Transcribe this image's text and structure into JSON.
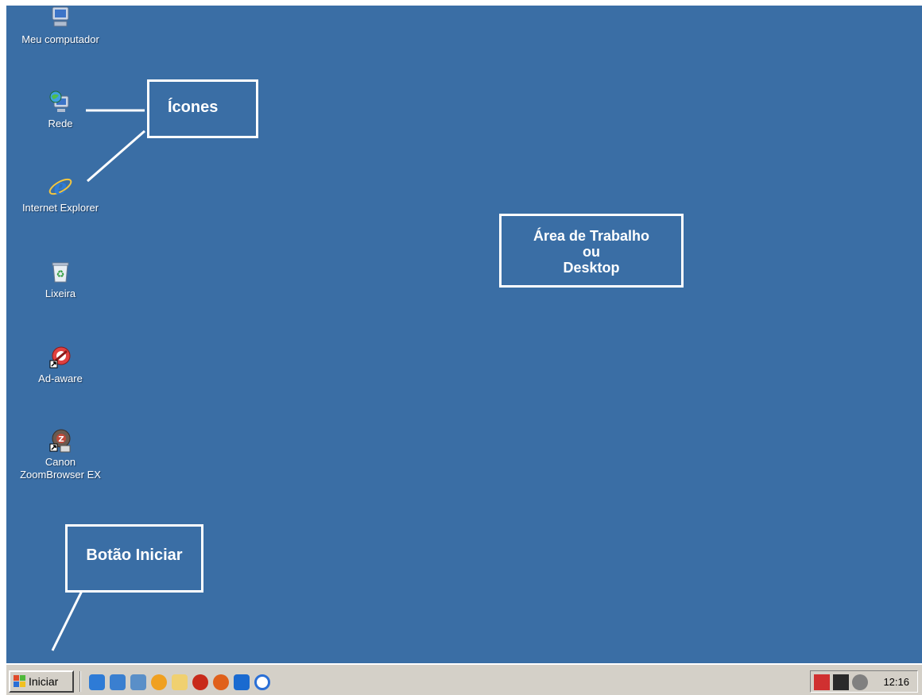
{
  "desktop": {
    "background_color": "#3a6ea5",
    "icons": [
      {
        "label": "Meu computador",
        "icon": "my-computer-icon"
      },
      {
        "label": "Rede",
        "icon": "network-icon"
      },
      {
        "label": "Internet Explorer",
        "icon": "internet-explorer-icon"
      },
      {
        "label": "Lixeira",
        "icon": "recycle-bin-icon"
      },
      {
        "label": "Ad-aware",
        "icon": "ad-aware-icon"
      },
      {
        "label": "Canon\nZoomBrowser EX",
        "label_line1": "Canon",
        "label_line2": "ZoomBrowser EX",
        "icon": "canon-zoombrowser-icon"
      }
    ]
  },
  "annotations": {
    "icones": "Ícones",
    "area_line1": "Área de Trabalho",
    "area_line2": "ou",
    "area_line3": "Desktop",
    "start_button": "Botão Iniciar"
  },
  "taskbar": {
    "start_label": "Iniciar",
    "quick_launch": [
      "internet-explorer-icon",
      "outlook-icon",
      "desktop-icon",
      "media-player-icon",
      "folder-icon",
      "antivirus-icon",
      "firefox-icon",
      "messenger-icon",
      "clock-app-icon"
    ],
    "tray_icons": [
      "security-icon",
      "calendar-icon",
      "volume-icon"
    ],
    "clock": "12:16"
  }
}
